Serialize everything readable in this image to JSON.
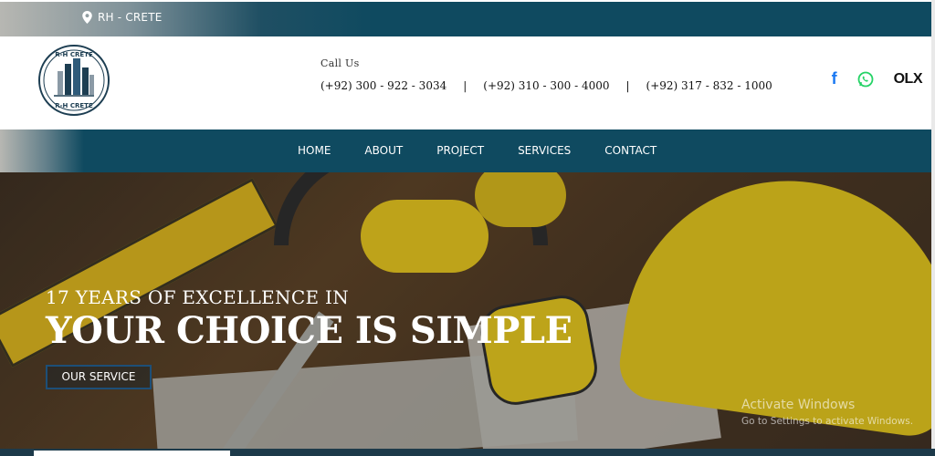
{
  "topbar": {
    "location_icon": "map-pin-icon",
    "location_text": "RH - CRETE"
  },
  "header": {
    "logo": {
      "text_top": "R-H CRETE",
      "text_bottom": "R-H CRETE"
    },
    "call_label": "Call Us",
    "phones": [
      "(+92) 300 - 922 - 3034",
      "(+92) 310 - 300 - 4000",
      "(+92) 317 - 832 - 1000"
    ],
    "separator": "|",
    "socials": [
      {
        "icon": "facebook-icon",
        "label": "f",
        "color": "#1877f2"
      },
      {
        "icon": "whatsapp-icon",
        "color": "#25d366"
      },
      {
        "icon": "olx-icon",
        "label": "OLX"
      }
    ]
  },
  "nav": {
    "items": [
      "HOME",
      "ABOUT",
      "PROJECT",
      "SERVICES",
      "CONTACT"
    ]
  },
  "hero": {
    "subtitle": "17 YEARS OF EXCELLENCE IN",
    "title": "YOUR CHOICE IS SIMPLE",
    "button_label": "OUR SERVICE"
  },
  "watermark": {
    "line1": "Activate Windows",
    "line2": "Go to Settings to activate Windows."
  },
  "colors": {
    "brand_teal": "#0f4a60",
    "accent_yellow": "#e0c21a",
    "button_border": "#1d4f78"
  }
}
